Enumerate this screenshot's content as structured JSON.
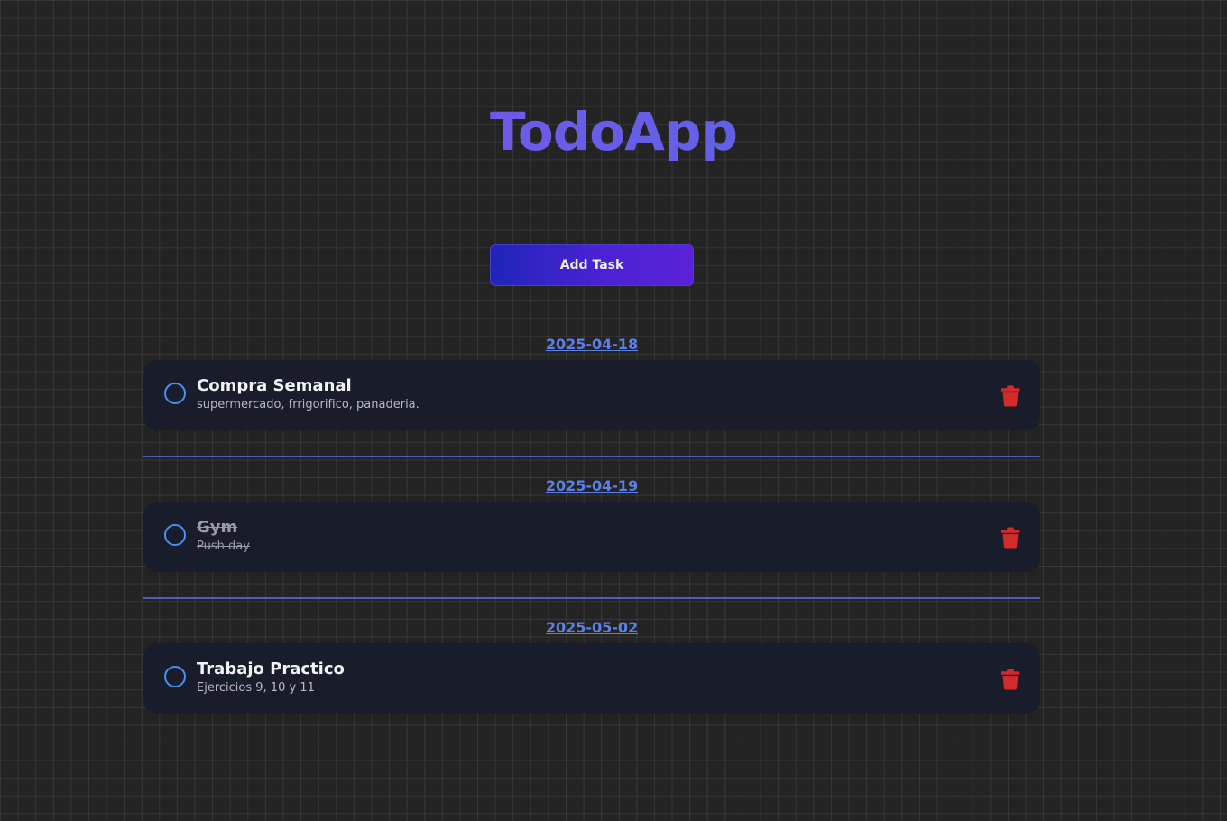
{
  "app": {
    "title": "TodoApp",
    "add_task_label": "Add Task"
  },
  "colors": {
    "accent": "#5c7fe8",
    "delete": "#d42a2a",
    "check": "#4b8ff0",
    "card": "#191c2a"
  },
  "groups": [
    {
      "date": "2025-04-18",
      "tasks": [
        {
          "title": "Compra Semanal",
          "description": "supermercado, frrigorifico, panaderia.",
          "completed": false
        }
      ]
    },
    {
      "date": "2025-04-19",
      "tasks": [
        {
          "title": "Gym",
          "description": "Push day",
          "completed": true
        }
      ]
    },
    {
      "date": "2025-05-02",
      "tasks": [
        {
          "title": "Trabajo Practico",
          "description": "Ejercicios 9, 10 y 11",
          "completed": false
        }
      ]
    }
  ],
  "icons": {
    "checkbox": "circle-outline-icon",
    "delete": "trash-icon"
  }
}
